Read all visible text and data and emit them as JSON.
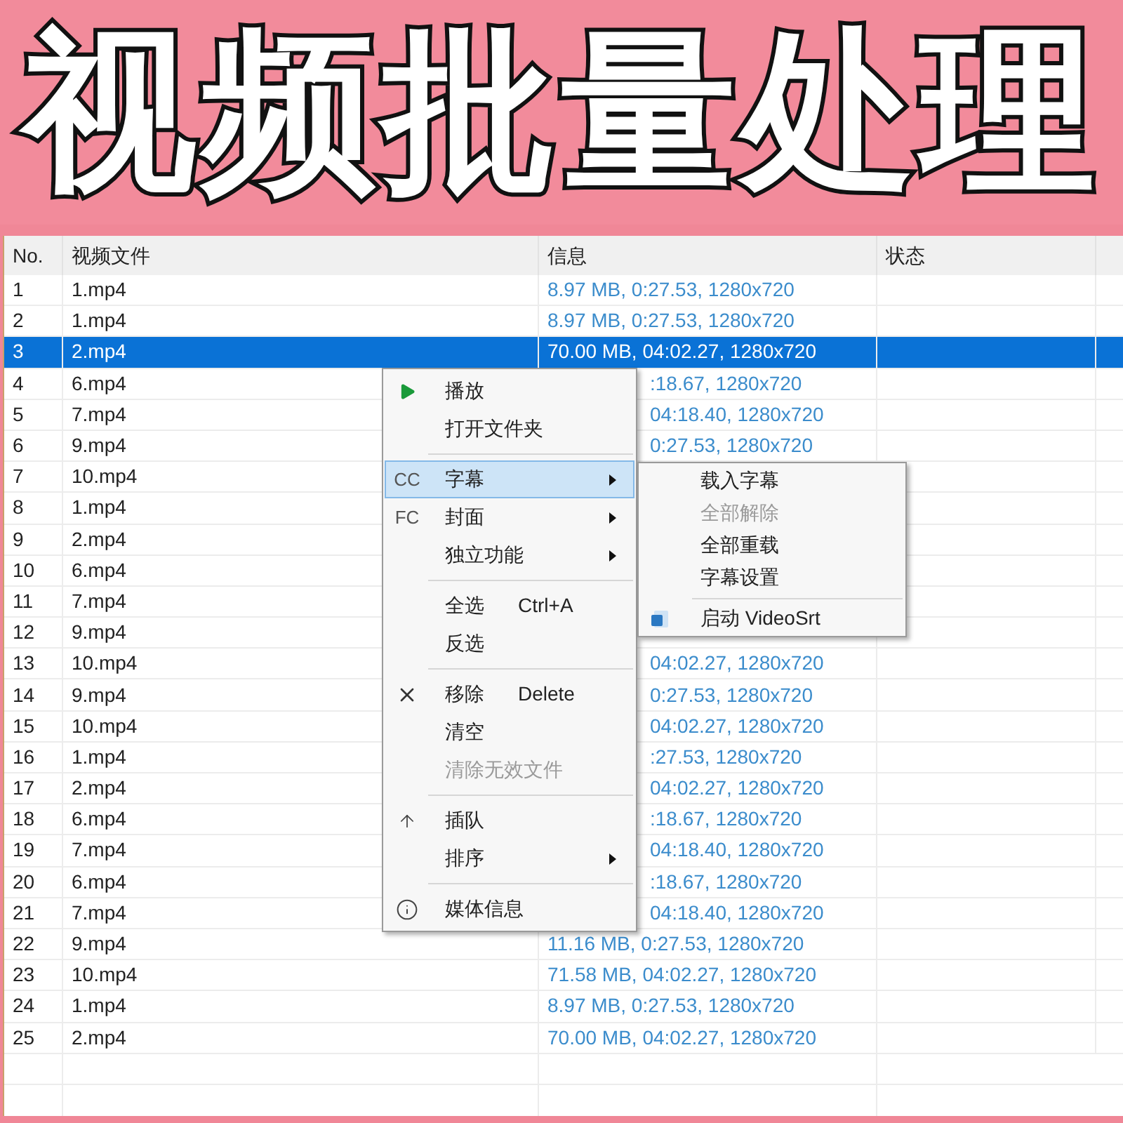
{
  "banner": {
    "title": "视频批量处理"
  },
  "table": {
    "columns": [
      "No.",
      "视频文件",
      "信息",
      "状态"
    ],
    "rows": [
      {
        "no": "1",
        "file": "1.mp4",
        "info": "8.97 MB, 0:27.53, 1280x720",
        "info_clipped": false,
        "selected": false
      },
      {
        "no": "2",
        "file": "1.mp4",
        "info": "8.97 MB, 0:27.53, 1280x720",
        "info_clipped": false,
        "selected": false
      },
      {
        "no": "3",
        "file": "2.mp4",
        "info": "70.00 MB, 04:02.27, 1280x720",
        "info_clipped": false,
        "selected": true
      },
      {
        "no": "4",
        "file": "6.mp4",
        "info": ":18.67, 1280x720",
        "info_clipped": true,
        "selected": false
      },
      {
        "no": "5",
        "file": "7.mp4",
        "info": "04:18.40, 1280x720",
        "info_clipped": true,
        "selected": false
      },
      {
        "no": "6",
        "file": "9.mp4",
        "info": "0:27.53, 1280x720",
        "info_clipped": true,
        "selected": false
      },
      {
        "no": "7",
        "file": "10.mp4",
        "selected": false
      },
      {
        "no": "8",
        "file": "1.mp4",
        "selected": false
      },
      {
        "no": "9",
        "file": "2.mp4",
        "selected": false
      },
      {
        "no": "10",
        "file": "6.mp4",
        "selected": false
      },
      {
        "no": "11",
        "file": "7.mp4",
        "selected": false
      },
      {
        "no": "12",
        "file": "9.mp4",
        "selected": false
      },
      {
        "no": "13",
        "file": "10.mp4",
        "info": "04:02.27, 1280x720",
        "info_clipped": true,
        "selected": false
      },
      {
        "no": "14",
        "file": "9.mp4",
        "info": "0:27.53, 1280x720",
        "info_clipped": true,
        "selected": false
      },
      {
        "no": "15",
        "file": "10.mp4",
        "info": "04:02.27, 1280x720",
        "info_clipped": true,
        "selected": false
      },
      {
        "no": "16",
        "file": "1.mp4",
        "info": ":27.53, 1280x720",
        "info_clipped": true,
        "selected": false
      },
      {
        "no": "17",
        "file": "2.mp4",
        "info": "04:02.27, 1280x720",
        "info_clipped": true,
        "selected": false
      },
      {
        "no": "18",
        "file": "6.mp4",
        "info": ":18.67, 1280x720",
        "info_clipped": true,
        "selected": false
      },
      {
        "no": "19",
        "file": "7.mp4",
        "info": "04:18.40, 1280x720",
        "info_clipped": true,
        "selected": false
      },
      {
        "no": "20",
        "file": "6.mp4",
        "info": ":18.67, 1280x720",
        "info_clipped": true,
        "selected": false
      },
      {
        "no": "21",
        "file": "7.mp4",
        "info": "04:18.40, 1280x720",
        "info_clipped": true,
        "selected": false
      },
      {
        "no": "22",
        "file": "9.mp4",
        "info": "11.16 MB, 0:27.53, 1280x720",
        "info_clipped": false,
        "selected": false
      },
      {
        "no": "23",
        "file": "10.mp4",
        "info": "71.58 MB, 04:02.27, 1280x720",
        "info_clipped": false,
        "selected": false
      },
      {
        "no": "24",
        "file": "1.mp4",
        "info": "8.97 MB, 0:27.53, 1280x720",
        "info_clipped": false,
        "selected": false
      },
      {
        "no": "25",
        "file": "2.mp4",
        "info": "70.00 MB, 04:02.27, 1280x720",
        "info_clipped": false,
        "selected": false
      }
    ]
  },
  "context_menu": {
    "items": [
      {
        "kind": "item",
        "label": "播放",
        "disabled": false,
        "selected": false,
        "submenu": false
      },
      {
        "kind": "item",
        "label": "打开文件夹",
        "disabled": false,
        "selected": false,
        "submenu": false
      },
      {
        "kind": "separator"
      },
      {
        "kind": "item",
        "icon_text": "CC",
        "label": "字幕",
        "disabled": false,
        "selected": true,
        "submenu": true
      },
      {
        "kind": "item",
        "icon_text": "FC",
        "label": "封面",
        "disabled": false,
        "selected": false,
        "submenu": true
      },
      {
        "kind": "item",
        "label": "独立功能",
        "disabled": false,
        "selected": false,
        "submenu": true
      },
      {
        "kind": "separator"
      },
      {
        "kind": "item",
        "label": "全选",
        "shortcut": "Ctrl+A",
        "disabled": false,
        "selected": false,
        "submenu": false
      },
      {
        "kind": "item",
        "label": "反选",
        "disabled": false,
        "selected": false,
        "submenu": false
      },
      {
        "kind": "separator"
      },
      {
        "kind": "item",
        "label": "移除",
        "shortcut": "Delete",
        "disabled": false,
        "selected": false,
        "submenu": false
      },
      {
        "kind": "item",
        "label": "清空",
        "disabled": false,
        "selected": false,
        "submenu": false
      },
      {
        "kind": "item",
        "label": "清除无效文件",
        "disabled": true,
        "selected": false,
        "submenu": false
      },
      {
        "kind": "separator"
      },
      {
        "kind": "item",
        "label": "插队",
        "disabled": false,
        "selected": false,
        "submenu": false
      },
      {
        "kind": "item",
        "label": "排序",
        "disabled": false,
        "selected": false,
        "submenu": true
      },
      {
        "kind": "separator"
      },
      {
        "kind": "item",
        "label": "媒体信息",
        "disabled": false,
        "selected": false,
        "submenu": false
      }
    ]
  },
  "submenu": {
    "items": [
      {
        "kind": "item",
        "label": "载入字幕",
        "disabled": false
      },
      {
        "kind": "item",
        "label": "全部解除",
        "disabled": true
      },
      {
        "kind": "item",
        "label": "全部重载",
        "disabled": false
      },
      {
        "kind": "item",
        "label": "字幕设置",
        "disabled": false
      },
      {
        "kind": "separator"
      },
      {
        "kind": "item",
        "label": "启动 VideoSrt",
        "disabled": false
      }
    ]
  }
}
